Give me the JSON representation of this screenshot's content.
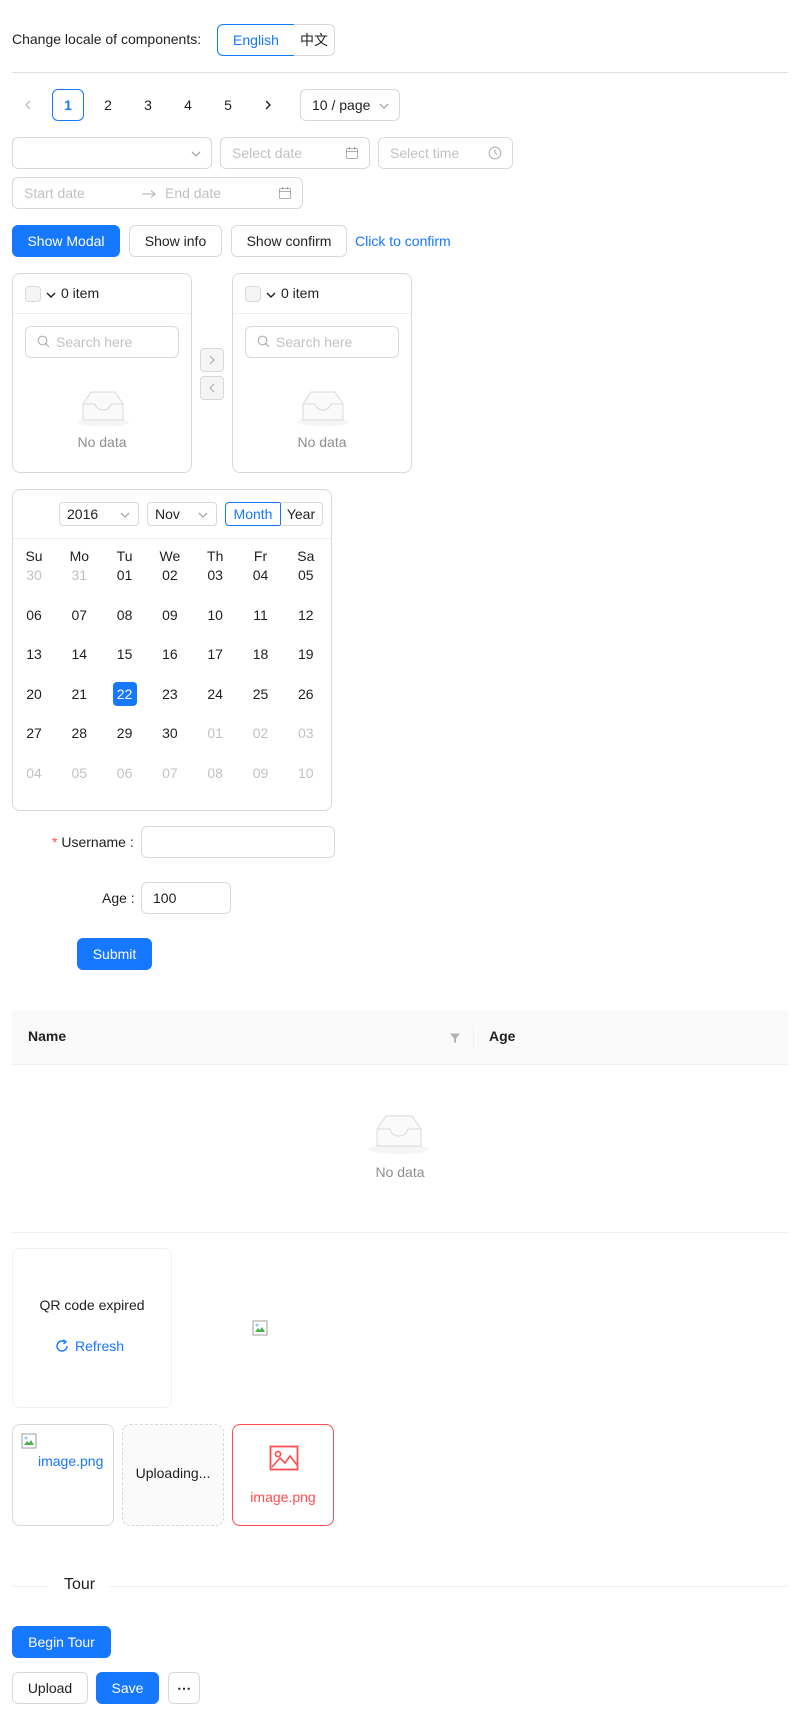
{
  "locale": {
    "label": "Change locale of components:",
    "options": [
      "English",
      "中文"
    ]
  },
  "pagination": {
    "pages": [
      "1",
      "2",
      "3",
      "4",
      "5"
    ],
    "current": "1",
    "page_size": "10 / page"
  },
  "pickers": {
    "select_value": "",
    "date_placeholder": "Select date",
    "time_placeholder": "Select time",
    "range_start_placeholder": "Start date",
    "range_end_placeholder": "End date"
  },
  "buttons": {
    "show_modal": "Show Modal",
    "show_info": "Show info",
    "show_confirm": "Show confirm",
    "click_to_confirm": "Click to confirm"
  },
  "transfer": {
    "left": {
      "count": "0 item",
      "search_placeholder": "Search here",
      "empty": "No data"
    },
    "right": {
      "count": "0 item",
      "search_placeholder": "Search here",
      "empty": "No data"
    }
  },
  "calendar": {
    "year": "2016",
    "month": "Nov",
    "modes": [
      "Month",
      "Year"
    ],
    "active_mode": "Month",
    "weekdays": [
      "Su",
      "Mo",
      "Tu",
      "We",
      "Th",
      "Fr",
      "Sa"
    ],
    "weeks": [
      [
        "30",
        "31",
        "01",
        "02",
        "03",
        "04",
        "05"
      ],
      [
        "06",
        "07",
        "08",
        "09",
        "10",
        "11",
        "12"
      ],
      [
        "13",
        "14",
        "15",
        "16",
        "17",
        "18",
        "19"
      ],
      [
        "20",
        "21",
        "22",
        "23",
        "24",
        "25",
        "26"
      ],
      [
        "27",
        "28",
        "29",
        "30",
        "01",
        "02",
        "03"
      ],
      [
        "04",
        "05",
        "06",
        "07",
        "08",
        "09",
        "10"
      ]
    ],
    "selected": "22"
  },
  "form": {
    "username_label": "Username",
    "username_value": "",
    "age_label": "Age",
    "age_value": "100",
    "submit": "Submit"
  },
  "table": {
    "columns": [
      "Name",
      "Age"
    ],
    "empty": "No data"
  },
  "qr": {
    "status": "QR code expired",
    "refresh": "Refresh"
  },
  "upload": {
    "items": [
      {
        "name": "image.png",
        "state": "done"
      },
      {
        "name": "Uploading...",
        "state": "uploading"
      },
      {
        "name": "image.png",
        "state": "error"
      }
    ]
  },
  "tour": {
    "divider_title": "Tour",
    "begin": "Begin Tour",
    "upload": "Upload",
    "save": "Save",
    "more": "⋯"
  },
  "colors": {
    "primary": "#1677ff",
    "error": "#ff4d4f",
    "required": "#ff4d4f"
  }
}
